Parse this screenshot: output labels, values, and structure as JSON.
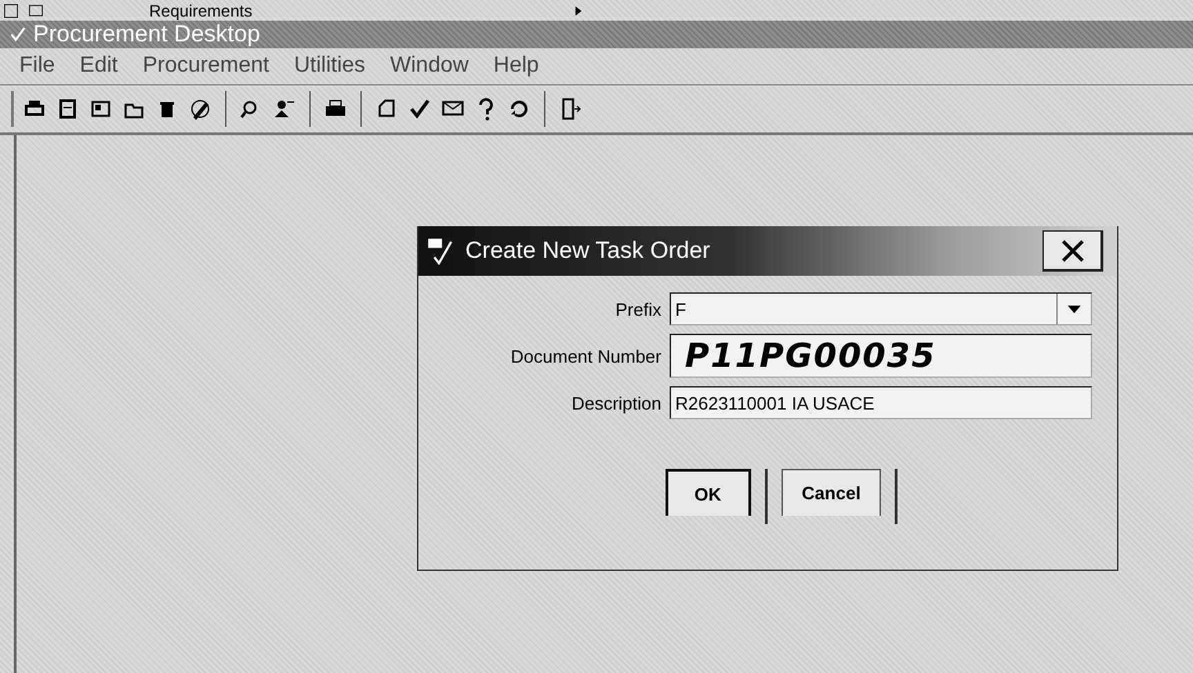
{
  "background_menu": {
    "label": "Requirements"
  },
  "window": {
    "title": "Procurement Desktop"
  },
  "menu": [
    {
      "label": "File"
    },
    {
      "label": "Edit"
    },
    {
      "label": "Procurement"
    },
    {
      "label": "Utilities"
    },
    {
      "label": "Window"
    },
    {
      "label": "Help"
    }
  ],
  "dialog": {
    "title": "Create New Task Order",
    "fields": [
      {
        "kind": "dropdown",
        "label": "Prefix",
        "value": "F"
      },
      {
        "kind": "handwritten",
        "label": "Document Number",
        "value": "P11PG00035"
      },
      {
        "kind": "text",
        "label": "Description",
        "value": "R2623110001 IA USACE"
      }
    ],
    "buttons": [
      {
        "label": "OK",
        "default": true
      },
      {
        "label": "Cancel",
        "default": false
      }
    ]
  }
}
